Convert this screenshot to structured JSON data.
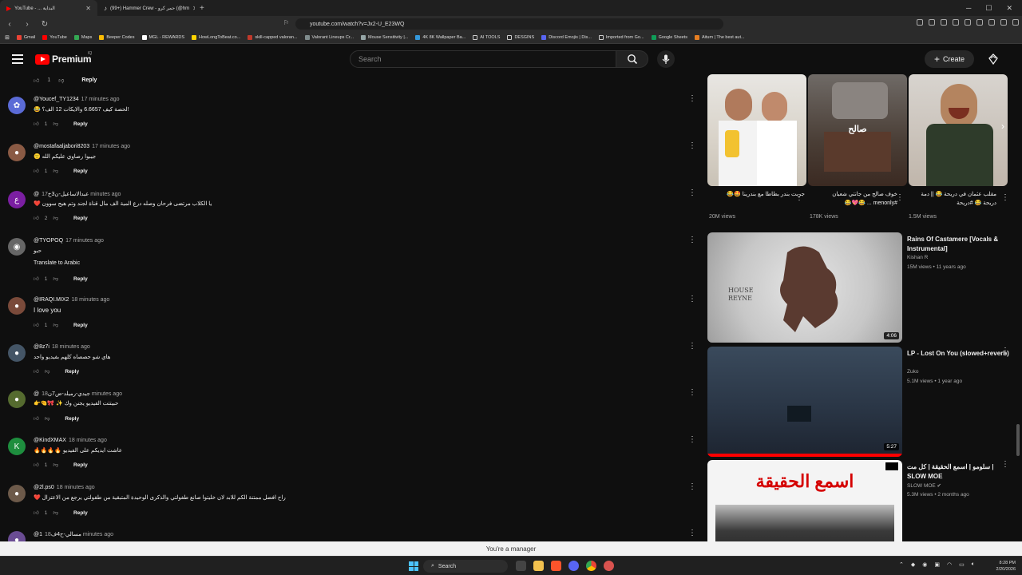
{
  "browser": {
    "tabs": [
      {
        "label": "YouTube - ... البداية",
        "active": true
      },
      {
        "label": "(99+) Hammer Crew - حمر كرو (@hm",
        "active": false
      }
    ],
    "url": "youtube.com/watch?v=Jx2-U_E23WQ",
    "bookmarks": [
      "Gmail",
      "YouTube",
      "Maps",
      "Beeper Codes",
      "MGL - REWARDS",
      "HowLongToBeat.co...",
      "skill-capped valoran...",
      "Valorant Lineups Cr...",
      "Mouse Sensitivity |...",
      "4K 8K Wallpaper Ba...",
      "AI TOOLS",
      "DESGINS",
      "Discord Emojis | Dis...",
      "Imported from Go...",
      "Google Sheets",
      "Aitum | The best aut..."
    ]
  },
  "header": {
    "logo_text": "Premium",
    "logo_badge": "IQ",
    "search_placeholder": "Search",
    "create_label": "Create"
  },
  "top_actions": {
    "likes": "1",
    "reply": "Reply"
  },
  "comments": [
    {
      "author": "@Youcef_TY1234",
      "time": "17 minutes ago",
      "text": "😂 لحصة كيف 6.6657 والايكات 12 الف؟!",
      "likes": "1",
      "reply": "Reply",
      "avatar_color": "#5b6bd6"
    },
    {
      "author": "@mostafaaljabori8203",
      "time": "17 minutes ago",
      "text": "🙂 جيبوا رصاوي عليكم الله",
      "likes": "1",
      "reply": "Reply",
      "avatar_color": "#8a5a44"
    },
    {
      "author": "@عبدالاساعيل-ن3خ",
      "time": "17 minutes ago",
      "text": "❤️ يا الكلاب مرتضى فرحان وصله درع المية الف مال قناة لجند وتم هيج سوون",
      "likes": "2",
      "reply": "Reply",
      "avatar_color": "#7b1fa2",
      "avatar_letter": "ع"
    },
    {
      "author": "@TYOPOQ",
      "time": "17 minutes ago",
      "text": "حبو",
      "translate": "Translate to Arabic",
      "likes": "1",
      "reply": "Reply",
      "avatar_color": "#666666"
    },
    {
      "author": "@IRAQI.MIX2",
      "time": "18 minutes ago",
      "text": "I love you",
      "likes": "1",
      "reply": "Reply",
      "avatar_color": "#7a4a3a"
    },
    {
      "author": "@8z7i",
      "time": "18 minutes ago",
      "text": "هاي شو حصصاه كلهم بفيديو واحد",
      "likes": "",
      "reply": "Reply",
      "avatar_color": "#445566"
    },
    {
      "author": "@جيدي-رميلد-ض7ن",
      "time": "18 minutes ago",
      "text": "👉🤏🎀 ✨ حبيتتت الفيديو يجنن وك",
      "likes": "",
      "reply": "Reply",
      "avatar_color": "#556b2f"
    },
    {
      "author": "@KindXMAX",
      "time": "18 minutes ago",
      "text": "🔥🔥🔥🔥 عاشت ايديكم على الفيديو",
      "likes": "1",
      "reply": "Reply",
      "avatar_color": "#1e8e3e",
      "avatar_letter": "K"
    },
    {
      "author": "@2l.ps0",
      "time": "18 minutes ago",
      "text": "❤️ راح افضل ممتنة الكم للابد لان خليتوا صانع طفولتي والذكرى الوحيدة المتبقية من طفولتي يرجع من الاعتزال",
      "likes": "1",
      "reply": "Reply",
      "avatar_color": "#6d5a4a"
    },
    {
      "author": "@مسالي-ح4ف1",
      "time": "18 minutes ago",
      "text": "",
      "likes": "",
      "reply": "",
      "avatar_color": "#6a4c93"
    }
  ],
  "shorts": [
    {
      "title": "جربت بندر بطاطا مع بندرينا 🤩😂",
      "views": "20M views"
    },
    {
      "title": "خوف صالح من جانتي شعبان #menonly ... 😂💖😂",
      "views": "178K views",
      "overlay": "صالح"
    },
    {
      "title": "مقلب عثمان في دريحة 😂 || دمة دريحة 😂 #دريحة",
      "views": "1.5M views"
    }
  ],
  "videos": [
    {
      "title": "Rains Of Castamere [Vocals & Instrumental]",
      "channel": "Kishan R",
      "meta": "15M views • 11 years ago",
      "duration": "4:06",
      "thumb_text": "HOUSE REYNE"
    },
    {
      "title": "LP - Lost On You (slowed+reverb)",
      "channel": "Zuko",
      "meta": "5.1M views • 1 year ago",
      "duration": "5:27"
    },
    {
      "title": "سلومو | اسمع الحقيقة | كل مت | SLOW MOE",
      "channel": "SLOW MOE ✔",
      "meta": "5.3M views • 2 months ago",
      "thumb_text": "اسمع الحقيقة"
    }
  ],
  "toast": "You're a manager",
  "taskbar": {
    "search": "Search",
    "time": "8:28 PM",
    "date": "2/20/2026"
  }
}
